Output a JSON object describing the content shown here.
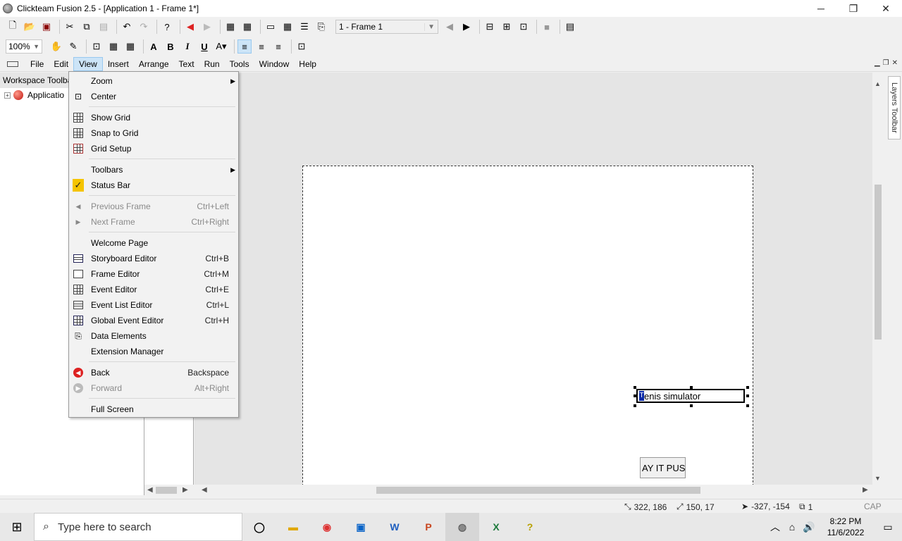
{
  "window": {
    "title": "Clickteam Fusion 2.5 - [Application 1 - Frame 1*]",
    "minimize": "─",
    "restore": "❐",
    "close": "✕"
  },
  "toolbar": {
    "frame_select": "1 - Frame 1",
    "zoom": "100%"
  },
  "menubar": {
    "items": [
      "File",
      "Edit",
      "View",
      "Insert",
      "Arrange",
      "Text",
      "Run",
      "Tools",
      "Window",
      "Help"
    ]
  },
  "workspace": {
    "title": "Workspace Toolba",
    "tree_item": "Applicatio"
  },
  "view_menu": {
    "items": [
      {
        "label": "Zoom",
        "shortcut": "",
        "icon": "none"
      },
      {
        "label": "Center",
        "shortcut": "",
        "icon": "center-icon"
      },
      {
        "label": "Show Grid",
        "shortcut": "",
        "icon": "grid-icon"
      },
      {
        "label": "Snap to Grid",
        "shortcut": "",
        "icon": "grid-icon"
      },
      {
        "label": "Grid Setup",
        "shortcut": "",
        "icon": "grid-setup-icon"
      },
      {
        "label": "Toolbars",
        "shortcut": "",
        "icon": "none"
      },
      {
        "label": "Status Bar",
        "shortcut": "",
        "icon": "check-icon"
      },
      {
        "label": "Previous Frame",
        "shortcut": "Ctrl+Left",
        "icon": "left-arrow-icon"
      },
      {
        "label": "Next Frame",
        "shortcut": "Ctrl+Right",
        "icon": "right-arrow-icon"
      },
      {
        "label": "Welcome Page",
        "shortcut": "",
        "icon": "none"
      },
      {
        "label": "Storyboard Editor",
        "shortcut": "Ctrl+B",
        "icon": "storyboard-icon"
      },
      {
        "label": "Frame Editor",
        "shortcut": "Ctrl+M",
        "icon": "frame-icon"
      },
      {
        "label": "Event Editor",
        "shortcut": "Ctrl+E",
        "icon": "grid-icon"
      },
      {
        "label": "Event List Editor",
        "shortcut": "Ctrl+L",
        "icon": "list-icon"
      },
      {
        "label": "Global Event Editor",
        "shortcut": "Ctrl+H",
        "icon": "grid-icon"
      },
      {
        "label": "Data Elements",
        "shortcut": "",
        "icon": "data-elements-icon"
      },
      {
        "label": "Extension Manager",
        "shortcut": "",
        "icon": "none"
      },
      {
        "label": "Back",
        "shortcut": "Backspace",
        "icon": "back-icon"
      },
      {
        "label": "Forward",
        "shortcut": "Alt+Right",
        "icon": "forward-icon"
      },
      {
        "label": "Full Screen",
        "shortcut": "",
        "icon": "none"
      }
    ]
  },
  "editor": {
    "text_object": "enis simulator",
    "text_cursor": "T",
    "button_object": "AY IT PUS"
  },
  "layers": {
    "tab": "Layers Toolbar"
  },
  "statusbar": {
    "position": "322, 186",
    "size": "150, 17",
    "offset": "-327, -154",
    "layer": "1",
    "keys": "CAP NUM"
  },
  "taskbar": {
    "search_placeholder": "Type here to search",
    "time": "8:22 PM",
    "date": "11/6/2022"
  },
  "colors": {
    "accent": "#0078d7",
    "menu_highlight": "#cce4f7"
  }
}
